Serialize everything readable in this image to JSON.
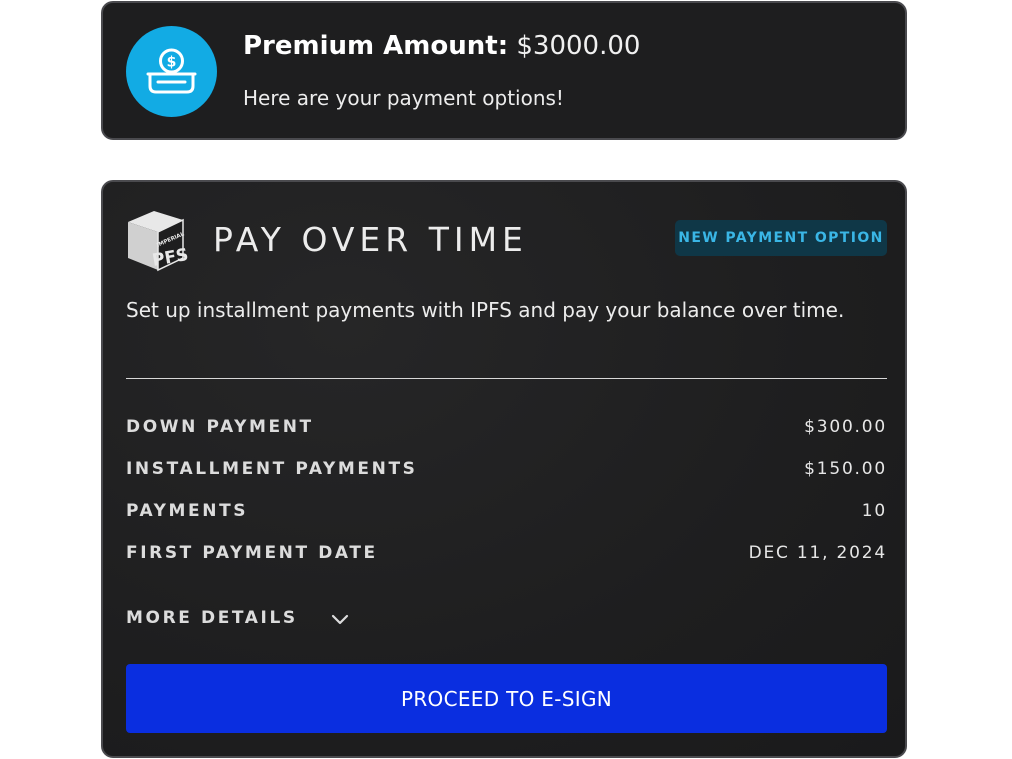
{
  "premium": {
    "icon": "payment-hand-dollar-icon",
    "label": "Premium Amount:",
    "amount": "$3000.00",
    "subtitle": "Here are your payment options!",
    "icon_bg_color": "#12abe4"
  },
  "plan": {
    "logo": "imperial-pfs-logo",
    "logo_text": [
      "IMPERIAL",
      "PFS"
    ],
    "title": "PAY OVER TIME",
    "badge": "NEW PAYMENT OPTION",
    "description": "Set up installment payments with IPFS and pay your balance over time.",
    "details": [
      {
        "label": "DOWN PAYMENT",
        "value": "$300.00"
      },
      {
        "label": "INSTALLMENT PAYMENTS",
        "value": "$150.00"
      },
      {
        "label": "PAYMENTS",
        "value": "10"
      },
      {
        "label": "FIRST PAYMENT DATE",
        "value": "DEC 11, 2024"
      }
    ],
    "more_details": "MORE DETAILS",
    "more_details_icon": "chevron-down-icon",
    "cta": "PROCEED TO E-SIGN",
    "cta_color": "#0a2ee0",
    "badge_color": "#3ab6e6"
  }
}
